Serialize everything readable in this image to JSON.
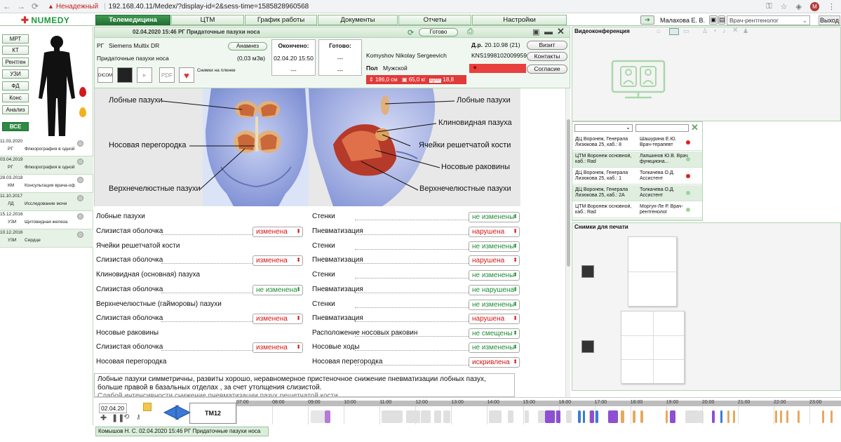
{
  "browser": {
    "insecure_label": "Ненадежный",
    "url": "192.168.40.11/Medex/?display-id=2&sess-time=1585828960568"
  },
  "app": {
    "logo": "NUMEDY",
    "tabs": [
      {
        "label": "Телемедицина",
        "active": true
      },
      {
        "label": "ЦТМ",
        "active": false
      },
      {
        "label": "График работы",
        "active": false
      },
      {
        "label": "Документы",
        "active": false
      },
      {
        "label": "Отчеты",
        "active": false
      },
      {
        "label": "Настройки",
        "active": false
      }
    ],
    "user_name": "Малахова Е. В.",
    "role": "Врач-рентгенолог",
    "exit_label": "Выход"
  },
  "modalities": [
    "МРТ",
    "КТ",
    "Рентген",
    "УЗИ",
    "ФД",
    "Конс",
    "Анализ",
    "ВСЕ"
  ],
  "history": [
    {
      "date": "11.03.2020",
      "mod": "РГ",
      "title": "Флюорография в одной"
    },
    {
      "date": "03.04.2019",
      "mod": "РГ",
      "title": "Флюорография в одной"
    },
    {
      "date": "28.03.2018",
      "mod": "КМ",
      "title": "Консультация врача-оф"
    },
    {
      "date": "11.10.2017",
      "mod": "ЛД",
      "title": "Исследование мочи"
    },
    {
      "date": "15.12.2016",
      "mod": "УЗИ",
      "title": "Щитовидная железа"
    },
    {
      "date": "10.12.2016",
      "mod": "УЗИ",
      "title": "Сердце"
    }
  ],
  "study": {
    "title": "02.04.2020 15:46 РГ Придаточные пазухи носа",
    "ready_btn": "Готово",
    "modality": "РГ",
    "device": "Siemens Multix DR",
    "anamnesis_btn": "Анамнез",
    "study_name": "Придаточные пазухи носа",
    "dose": "(0,03 мЗв)",
    "finished_label": "Окончено:",
    "finished_value": "02.04.20 15:50",
    "finished_sub": "---",
    "ready_label": "Готово:",
    "ready_value": "---",
    "ready_sub": "---",
    "patient_name": "Komyshov Nikolay Sergeevich",
    "dob_label": "Д.р.",
    "dob": "20.10.98 (21)",
    "patient_id": "KNS1998102009959",
    "sex_label": "Пол",
    "sex": "Мужской",
    "height": "186,0 см",
    "weight": "65,0 кг",
    "bmi_unit": "kg/m²",
    "bmi": "18,8",
    "visit_btn": "Визит",
    "contacts_btn": "Контакты",
    "consent_btn": "Согласие",
    "film_label": "Снимки на пленке",
    "tools": [
      "DICOM",
      "",
      "",
      "PDF"
    ]
  },
  "diagram_labels": {
    "l1": "Лобные пазухи",
    "l2": "Носовая перегородка",
    "l3": "Верхнечелюстные пазухи",
    "r1": "Лобные пазухи",
    "r2": "Клиновидная пазуха",
    "r3": "Ячейки решетчатой кости",
    "r4": "Носовые раковины",
    "r5": "Верхнечелюстные пазухи"
  },
  "form": {
    "left": [
      {
        "label": "Лобные пазухи",
        "kind": "header"
      },
      {
        "label": "Слизистая оболочка",
        "value": "изменена",
        "state": "red"
      },
      {
        "label": "Ячейки решетчатой кости",
        "kind": "header"
      },
      {
        "label": "Слизистая оболочка",
        "value": "изменена",
        "state": "red"
      },
      {
        "label": "Клиновидная (основная) пазуха",
        "kind": "header"
      },
      {
        "label": "Слизистая оболочка",
        "value": "не изменена",
        "state": "green"
      },
      {
        "label": "Верхнечелюстные (гайморовы) пазухи",
        "kind": "header"
      },
      {
        "label": "Слизистая оболочка",
        "value": "изменена",
        "state": "red"
      },
      {
        "label": "Носовые раковины",
        "kind": "header"
      },
      {
        "label": "Слизистая оболочка",
        "value": "изменена",
        "state": "red"
      },
      {
        "label": "Носовая перегородка",
        "kind": "header"
      }
    ],
    "right": [
      {
        "label": "Стенки",
        "value": "не изменены",
        "state": "green"
      },
      {
        "label": "Пневматизация",
        "value": "нарушена",
        "state": "red"
      },
      {
        "label": "Стенки",
        "value": "не изменены",
        "state": "green"
      },
      {
        "label": "Пневматизация",
        "value": "нарушена",
        "state": "red"
      },
      {
        "label": "Стенки",
        "value": "не изменены",
        "state": "green"
      },
      {
        "label": "Пневматизация",
        "value": "не нарушена",
        "state": "green"
      },
      {
        "label": "Стенки",
        "value": "не изменены",
        "state": "green"
      },
      {
        "label": "Пневматизация",
        "value": "нарушена",
        "state": "red"
      },
      {
        "label": "Расположение носовых раковин",
        "value": "не смещены",
        "state": "green"
      },
      {
        "label": "Носовые ходы",
        "value": "не изменены",
        "state": "green"
      },
      {
        "label": "Носовая перегородка",
        "value": "искривлена",
        "state": "red"
      }
    ]
  },
  "conclusion": "Лобные пазухи симметричны, развиты хорошо, неравномерное пристеночное снижение пневматизации лобных пазух, больше правой в базальных отделах ,  за счет утолщения слизистой.",
  "conclusion_partial": "Слабой интенсивности снижение пневматизации пазух решетчатой кости",
  "video": {
    "title": "Видеоконференция"
  },
  "people": [
    {
      "a": "ДЦ Воронеж, Генерала Лизюкова 25, каб.: 8",
      "b": "Шашурина Е.Ю. Врач-терапевт",
      "status": "red"
    },
    {
      "a": "ЦТМ Воронеж основной, каб.: Rad",
      "b": "Лапшинов Ю.В. Врач функциона...",
      "status": "green"
    },
    {
      "a": "ДЦ Воронеж, Генерала Лизюкова 25, каб.: 1",
      "b": "Толкачева О.Д. Ассистент",
      "status": "red"
    },
    {
      "a": "ДЦ Воронеж, Генерала Лизюкова 25, каб.: 2А",
      "b": "Толкачева О.Д. Ассистент",
      "status": "green"
    },
    {
      "a": "ЦТМ Воронеж основной, каб.: Rad",
      "b": "Моргун-Ле Р. Врач-рентгенолог",
      "status": "green"
    },
    {
      "a": "ЦТМ Воронеж основной",
      "b": "Моргун-Ле Р.",
      "status": "green"
    }
  ],
  "print": {
    "title": "Снимки для печати"
  },
  "timeline": {
    "date": "02.04.20",
    "room": "ТМ12",
    "hours": [
      "07:00",
      "08:00",
      "09:00",
      "10:00",
      "11:00",
      "12:00",
      "13:00",
      "14:00",
      "15:00",
      "16:00",
      "17:00",
      "18:00",
      "19:00",
      "20:00",
      "21:00",
      "22:00",
      "23:00"
    ]
  },
  "status": "Комышов Н. С. 02.04.2020 15:46 РГ Придаточные пазухи носа",
  "colors": {
    "brand": "#2f8a42",
    "red": "#d71414",
    "green": "#1c8e33"
  }
}
